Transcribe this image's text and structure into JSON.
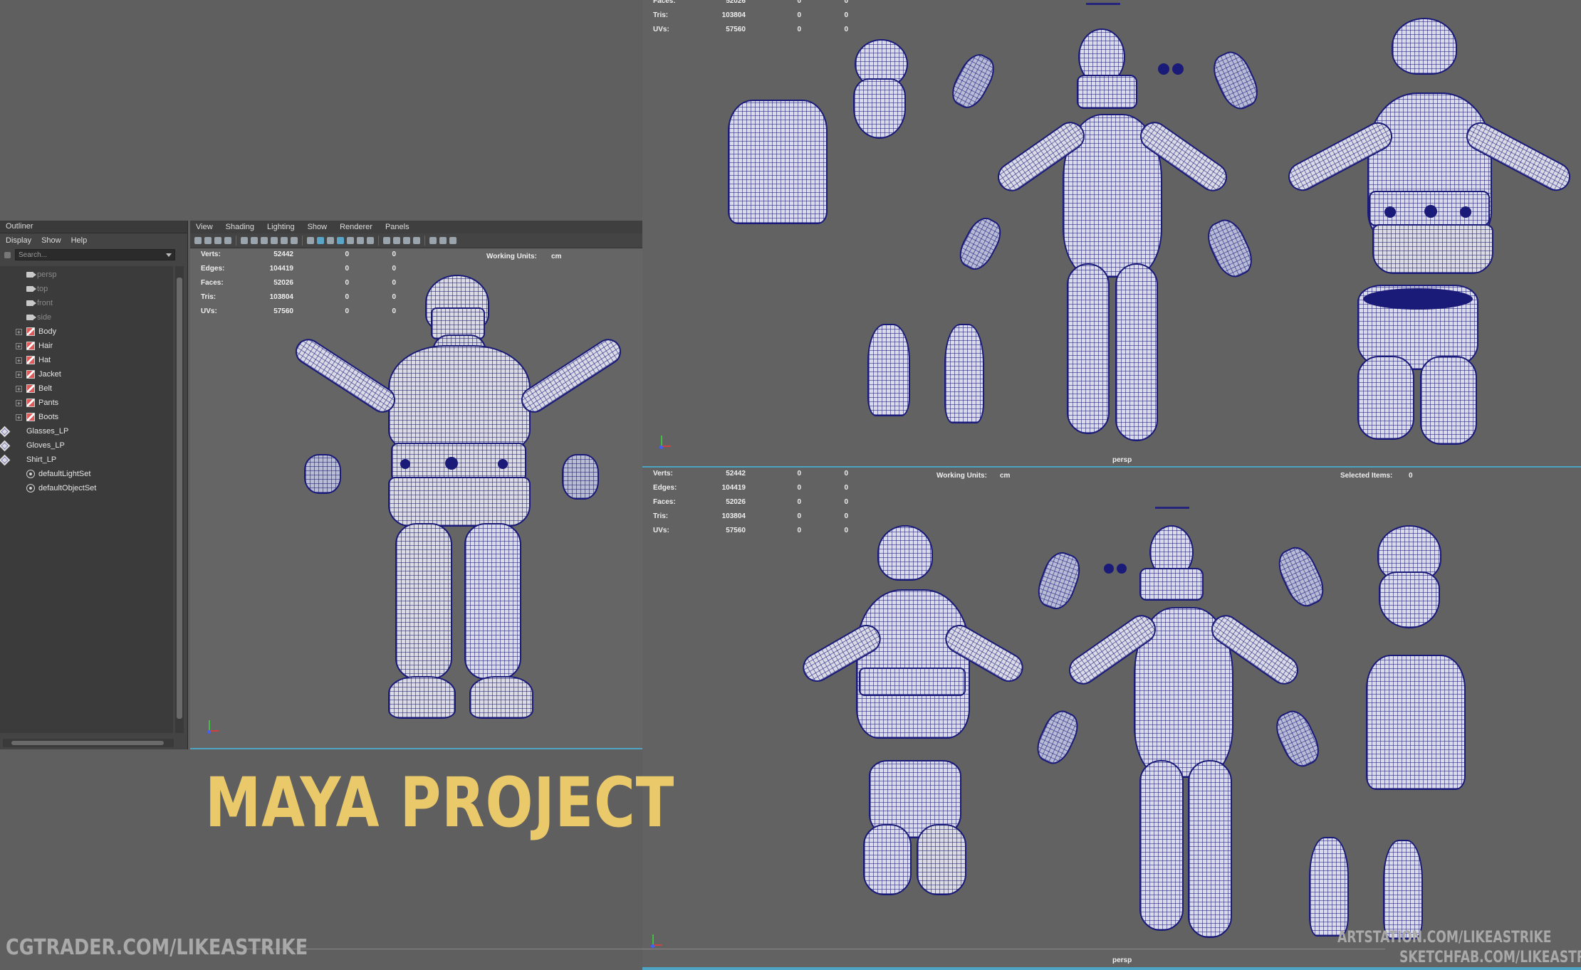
{
  "outliner": {
    "title": "Outliner",
    "menu": [
      "Display",
      "Show",
      "Help"
    ],
    "search_placeholder": "Search...",
    "items": [
      {
        "label": "persp",
        "icon": "camera-icon"
      },
      {
        "label": "top",
        "icon": "camera-icon"
      },
      {
        "label": "front",
        "icon": "camera-icon"
      },
      {
        "label": "side",
        "icon": "camera-icon"
      },
      {
        "label": "Body",
        "icon": "group-icon"
      },
      {
        "label": "Hair",
        "icon": "group-icon"
      },
      {
        "label": "Hat",
        "icon": "group-icon"
      },
      {
        "label": "Jacket",
        "icon": "group-icon"
      },
      {
        "label": "Belt",
        "icon": "group-icon"
      },
      {
        "label": "Pants",
        "icon": "group-icon"
      },
      {
        "label": "Boots",
        "icon": "group-icon"
      },
      {
        "label": "Glasses_LP",
        "icon": "mesh-icon"
      },
      {
        "label": "Gloves_LP",
        "icon": "mesh-icon"
      },
      {
        "label": "Shirt_LP",
        "icon": "mesh-icon"
      },
      {
        "label": "defaultLightSet",
        "icon": "set-icon"
      },
      {
        "label": "defaultObjectSet",
        "icon": "set-icon"
      }
    ]
  },
  "viewport": {
    "menu": [
      "View",
      "Shading",
      "Lighting",
      "Show",
      "Renderer",
      "Panels"
    ],
    "hud": {
      "rows": [
        {
          "label": "Verts:",
          "v1": "52442",
          "v2": "0",
          "v3": "0"
        },
        {
          "label": "Edges:",
          "v1": "104419",
          "v2": "0",
          "v3": "0"
        },
        {
          "label": "Faces:",
          "v1": "52026",
          "v2": "0",
          "v3": "0"
        },
        {
          "label": "Tris:",
          "v1": "103804",
          "v2": "0",
          "v3": "0"
        },
        {
          "label": "UVs:",
          "v1": "57560",
          "v2": "0",
          "v3": "0"
        }
      ],
      "working_units_label": "Working Units:",
      "working_units_value": "cm",
      "selected_items_label": "Selected Items:",
      "selected_items_value": "0"
    },
    "top_partial_rows": [
      {
        "label": "Faces:",
        "v1": "52026",
        "v2": "0",
        "v3": "0"
      },
      {
        "label": "Tris:",
        "v1": "103804",
        "v2": "0",
        "v3": "0"
      },
      {
        "label": "UVs:",
        "v1": "57560",
        "v2": "0",
        "v3": "0"
      }
    ],
    "camera_label": "persp"
  },
  "overlay": {
    "title": "MAYA PROJECT",
    "footer_left": "CGTRADER.COM/LIKEASTRIKE",
    "footer_right_1": "ARTSTATION.COM/LIKEASTRIKE",
    "footer_right_2": "SKETCHFAB.COM/LIKEASTRIKE"
  }
}
